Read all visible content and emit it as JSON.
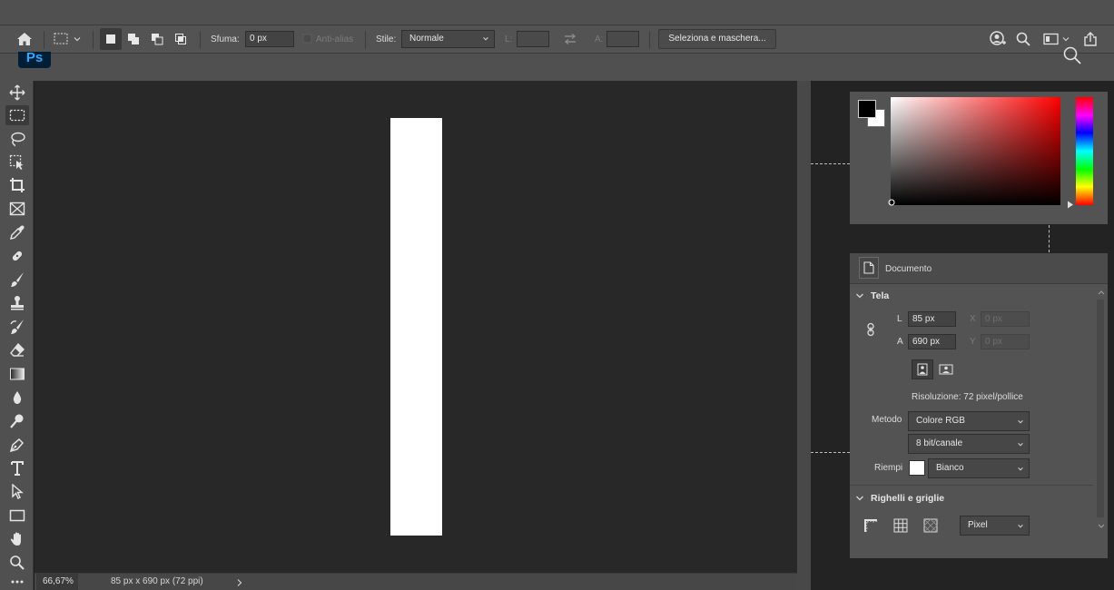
{
  "app": {
    "logo_text": "Ps"
  },
  "options_bar": {
    "feather_label": "Sfuma:",
    "feather_value": "0 px",
    "antialias_label": "Anti-alias",
    "style_label": "Stile:",
    "style_value": "Normale",
    "width_label": "L:",
    "height_label": "A:",
    "select_mask_button": "Seleziona e maschera..."
  },
  "status_bar": {
    "zoom": "66,67%",
    "doc_info": "85 px x 690 px (72 ppi)"
  },
  "color_picker": {
    "foreground": "#000000",
    "background": "#ffffff",
    "hue": "#ff0000"
  },
  "properties": {
    "tab_title": "Documento",
    "canvas_section": "Tela",
    "width_label": "L",
    "width_value": "85 px",
    "height_label": "A",
    "height_value": "690 px",
    "x_label": "X",
    "x_value": "0 px",
    "y_label": "Y",
    "y_value": "0 px",
    "resolution": "Risoluzione: 72 pixel/pollice",
    "mode_label": "Metodo",
    "mode_value": "Colore RGB",
    "bit_depth_value": "8 bit/canale",
    "fill_label": "Riempi",
    "fill_value": "Bianco",
    "fill_color": "#ffffff",
    "rulers_section": "Righelli e griglie",
    "units_value": "Pixel"
  },
  "theme": {
    "canvas_bg": "#282828",
    "panel_bg": "#535353",
    "document_fill": "#ffffff"
  }
}
